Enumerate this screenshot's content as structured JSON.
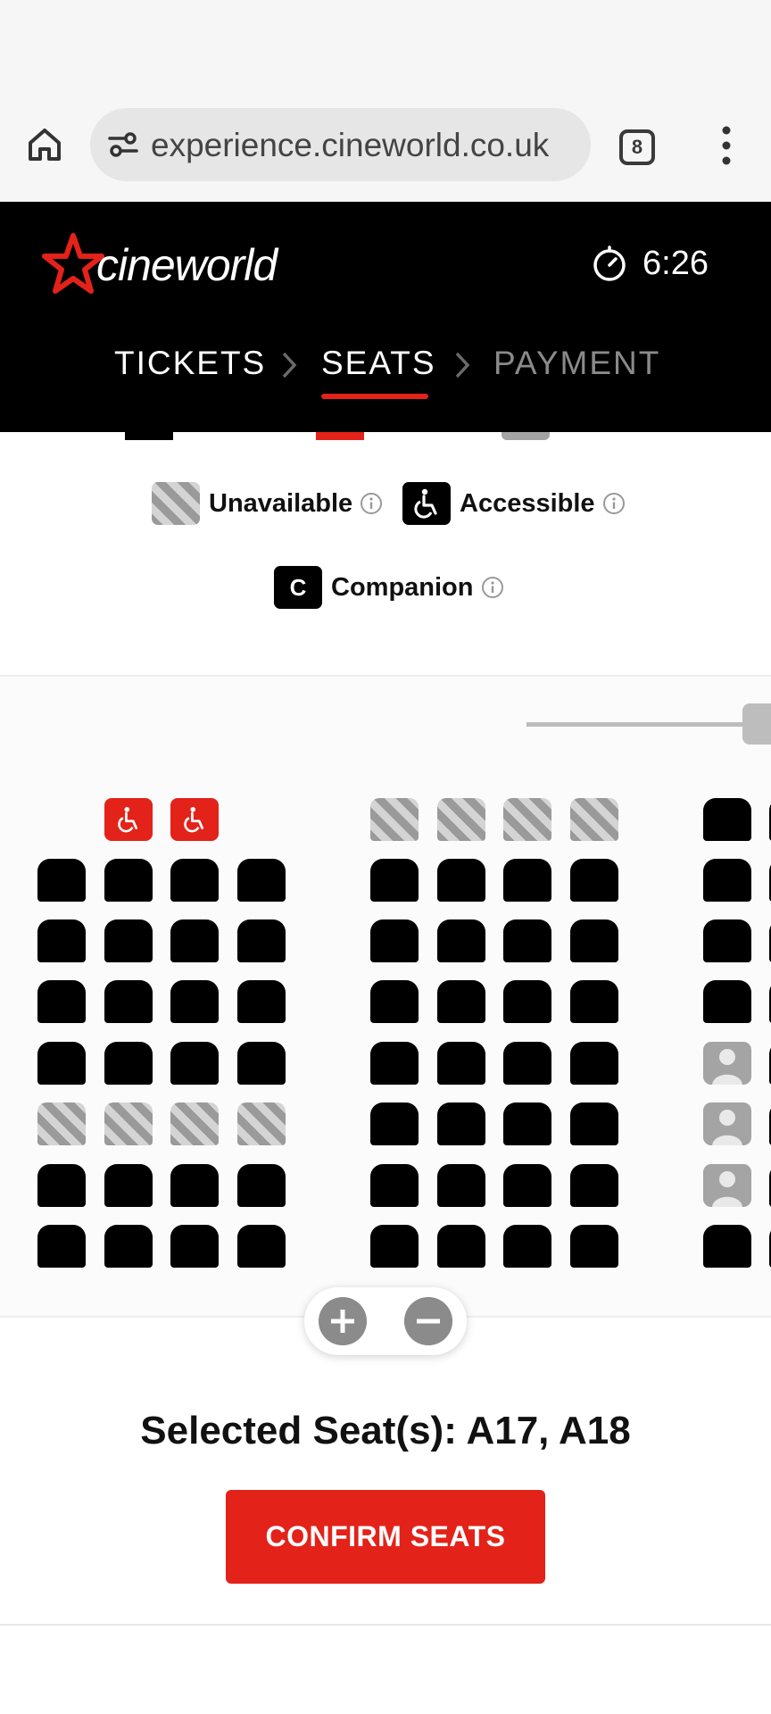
{
  "browser": {
    "url": "experience.cineworld.co.uk",
    "tab_count": "8"
  },
  "header": {
    "brand": "cineworld",
    "timer": "6:26",
    "steps": [
      {
        "label": "TICKETS",
        "state": "done"
      },
      {
        "label": "SEATS",
        "state": "active"
      },
      {
        "label": "PAYMENT",
        "state": "upcoming"
      }
    ]
  },
  "legend": {
    "unavailable": "Unavailable",
    "accessible": "Accessible",
    "companion": "Companion",
    "companion_swatch": "C"
  },
  "seatmap": {
    "seat_types": [
      "available",
      "unavailable",
      "accessible-selected",
      "occupied"
    ],
    "colors": {
      "available": "#000000",
      "accent": "#e32219",
      "unavailable_stripe": "#9a9a9a",
      "occupied": "#a4a4a4"
    }
  },
  "selection": {
    "text": "Selected Seat(s): A17, A18",
    "seats": [
      "A17",
      "A18"
    ]
  },
  "actions": {
    "confirm_label": "CONFIRM SEATS"
  }
}
